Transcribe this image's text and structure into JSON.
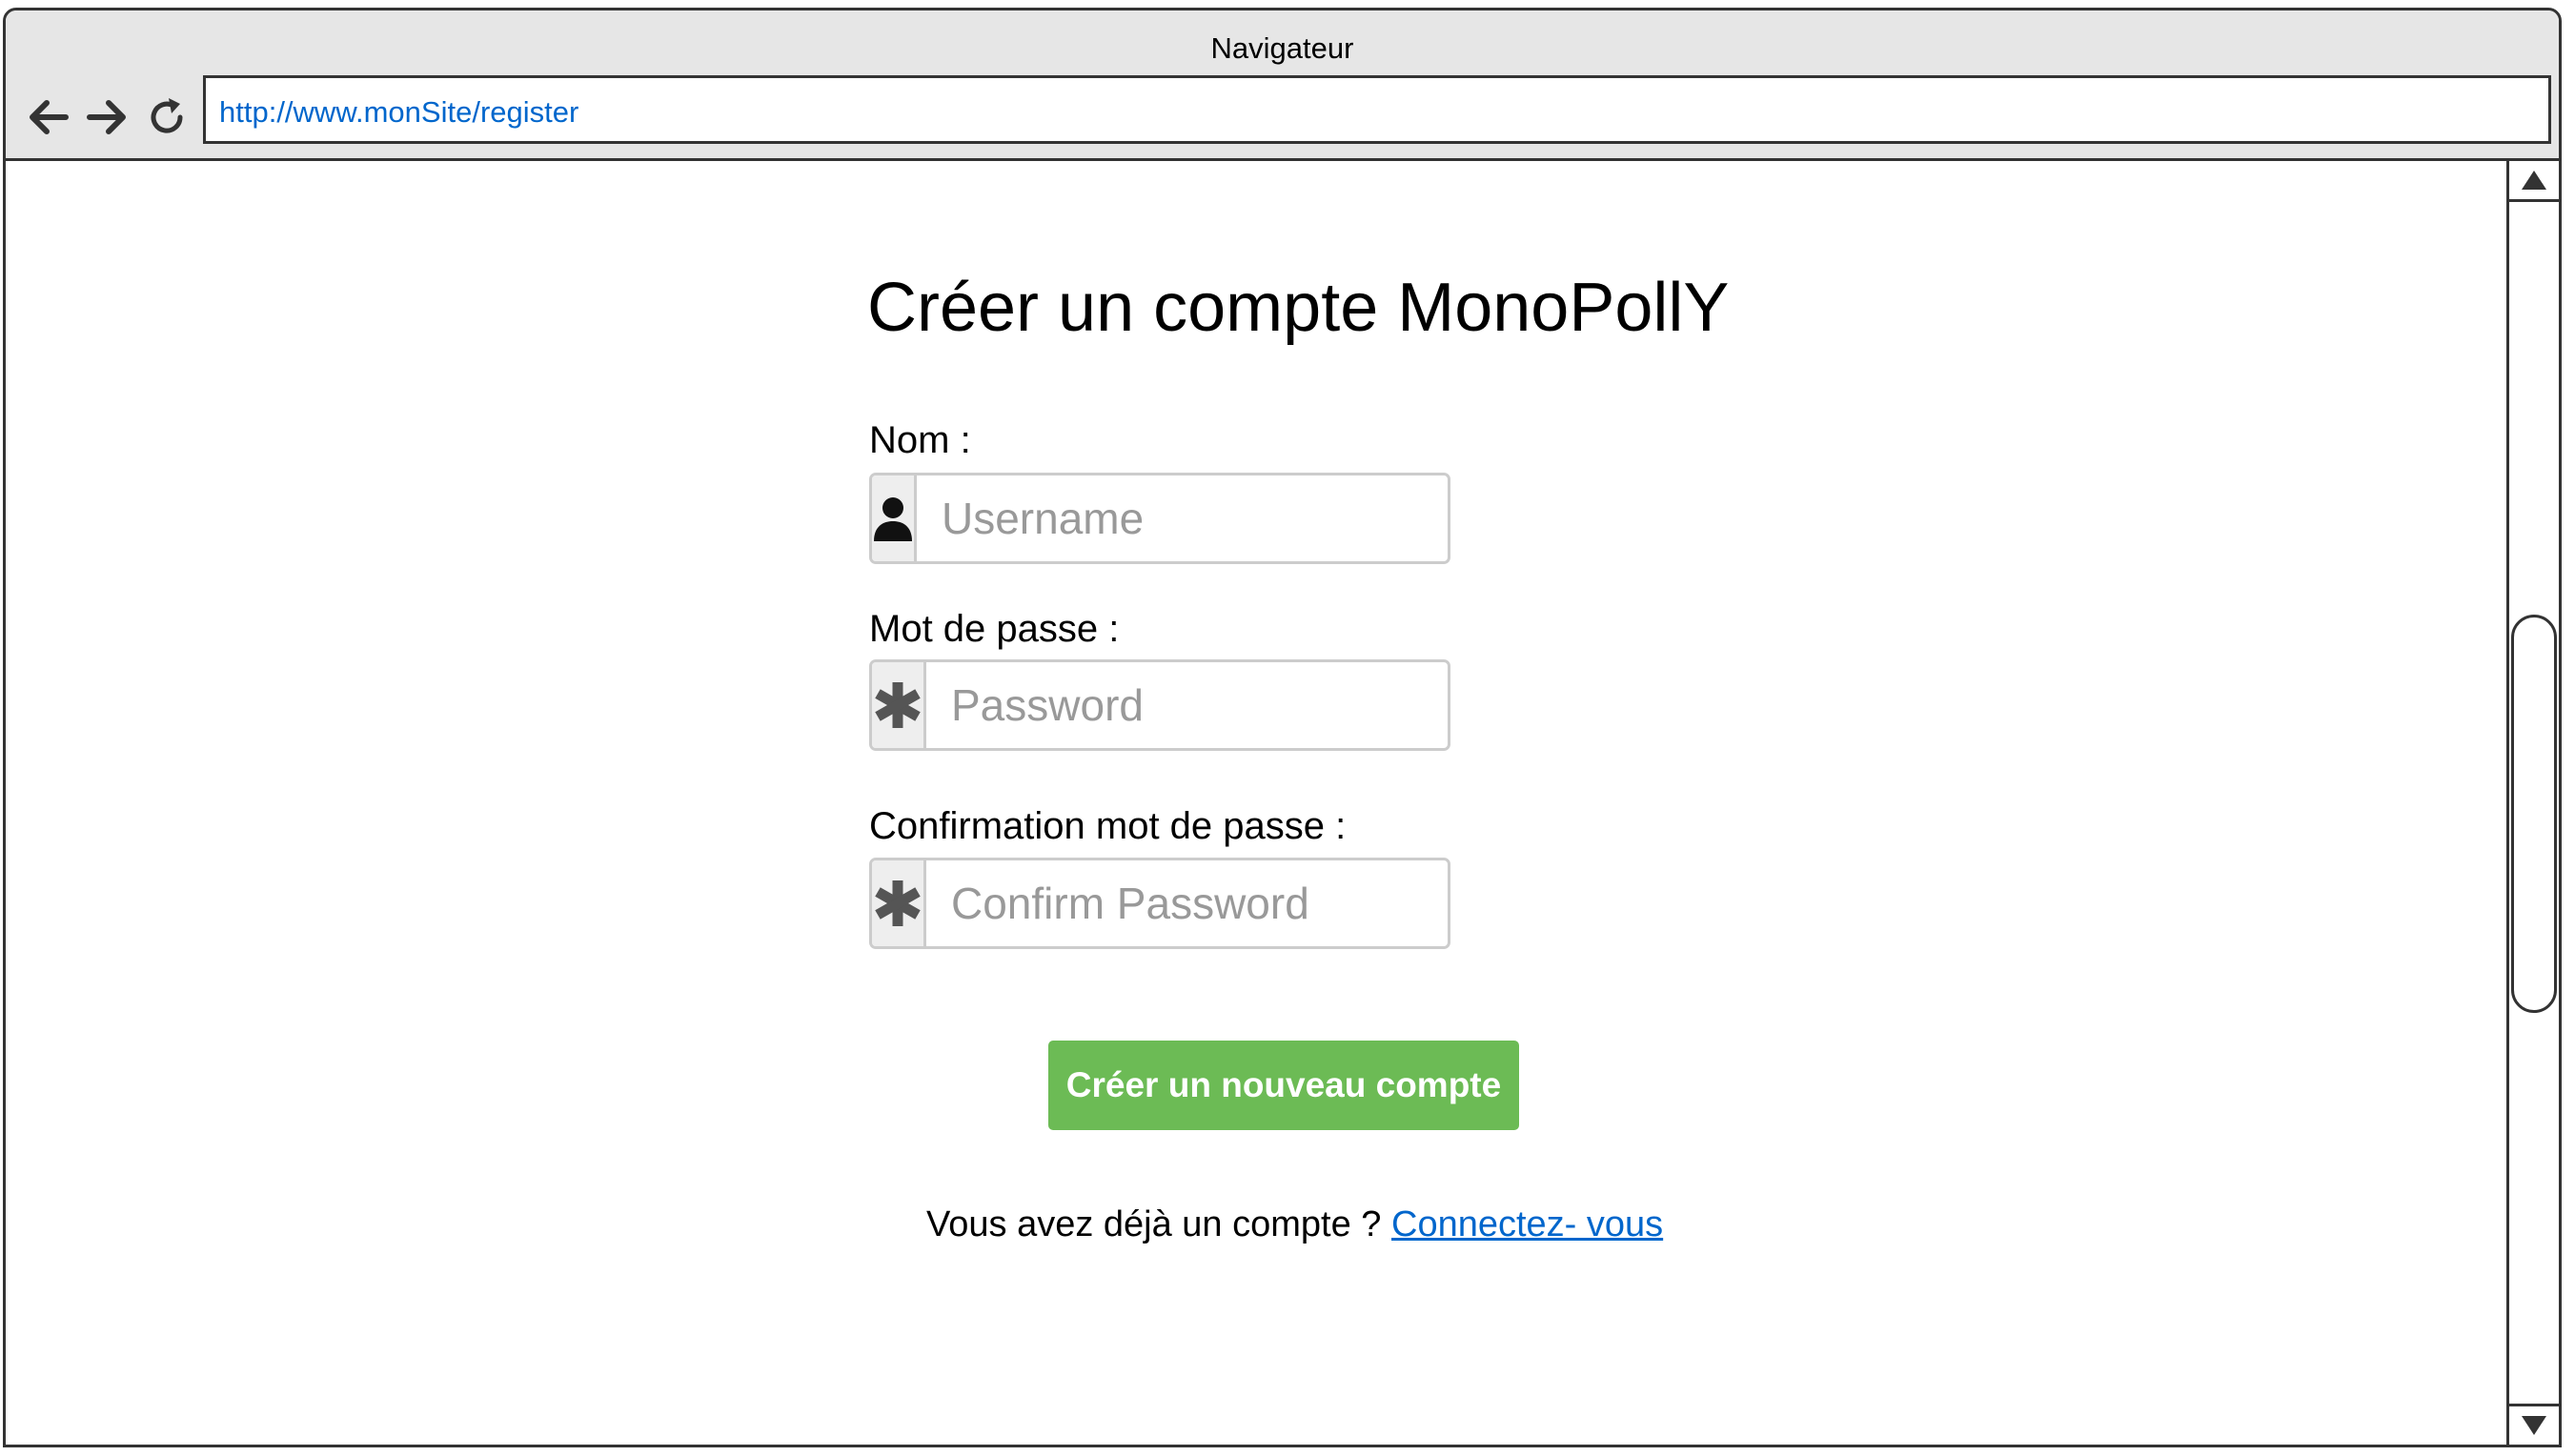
{
  "browser": {
    "title": "Navigateur",
    "url": "http://www.monSite/register",
    "icons": [
      "back-arrow-icon",
      "forward-arrow-icon",
      "reload-icon"
    ]
  },
  "form": {
    "title": "Créer un compte MonoPollY",
    "username": {
      "label": "Nom :",
      "placeholder": "Username",
      "icon": "user-icon"
    },
    "password": {
      "label": "Mot de passe :",
      "placeholder": "Password",
      "icon": "asterisk-icon"
    },
    "confirm": {
      "label": "Confirmation mot de passe :",
      "placeholder": "Confirm Password",
      "icon": "asterisk-icon"
    },
    "submit_label": "Créer un nouveau compte",
    "login_prompt": "Vous avez déjà un compte ? ",
    "login_link": "Connectez- vous"
  },
  "colors": {
    "button": "#6cbb55",
    "link": "#0066cc",
    "placeholder": "#999999",
    "chrome": "#e6e6e6"
  }
}
